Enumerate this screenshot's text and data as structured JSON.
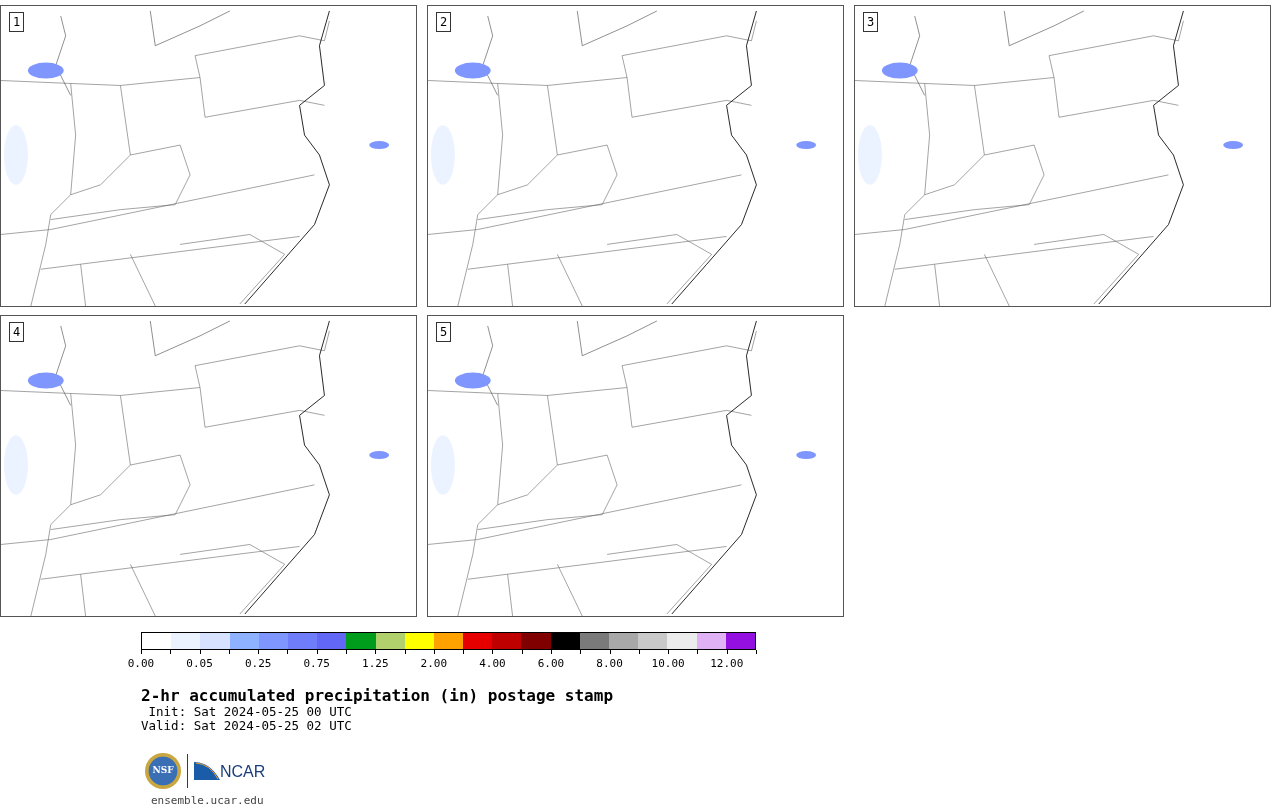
{
  "panels": [
    {
      "label": "1"
    },
    {
      "label": "2"
    },
    {
      "label": "3"
    },
    {
      "label": "4"
    },
    {
      "label": "5"
    }
  ],
  "colorbar": {
    "swatches": [
      {
        "color": "#ffffff"
      },
      {
        "color": "#eaf3ff"
      },
      {
        "color": "#d6e2ff"
      },
      {
        "color": "#8eb2ff"
      },
      {
        "color": "#7f96ff"
      },
      {
        "color": "#6f7dfa"
      },
      {
        "color": "#6367f5"
      },
      {
        "color": "#009c1c"
      },
      {
        "color": "#b0d16b"
      },
      {
        "color": "#ffff00"
      },
      {
        "color": "#ffa200"
      },
      {
        "color": "#e60000"
      },
      {
        "color": "#bf0000"
      },
      {
        "color": "#800000"
      },
      {
        "color": "#000000"
      },
      {
        "color": "#7a7a7a"
      },
      {
        "color": "#a8a8a8"
      },
      {
        "color": "#c9c9c9"
      },
      {
        "color": "#ececec"
      },
      {
        "color": "#e0b2f5"
      },
      {
        "color": "#9410e0"
      }
    ],
    "labels": [
      "0.00",
      "0.05",
      "0.25",
      "0.75",
      "1.25",
      "2.00",
      "4.00",
      "6.00",
      "8.00",
      "10.00",
      "12.00"
    ]
  },
  "title": "2-hr accumulated precipitation (in) postage stamp",
  "init": " Init: Sat 2024-05-25 00 UTC",
  "valid": "Valid: Sat 2024-05-25 02 UTC",
  "logo": {
    "nsf": "NSF",
    "ncar": "NCAR"
  },
  "url": "ensemble.ucar.edu"
}
